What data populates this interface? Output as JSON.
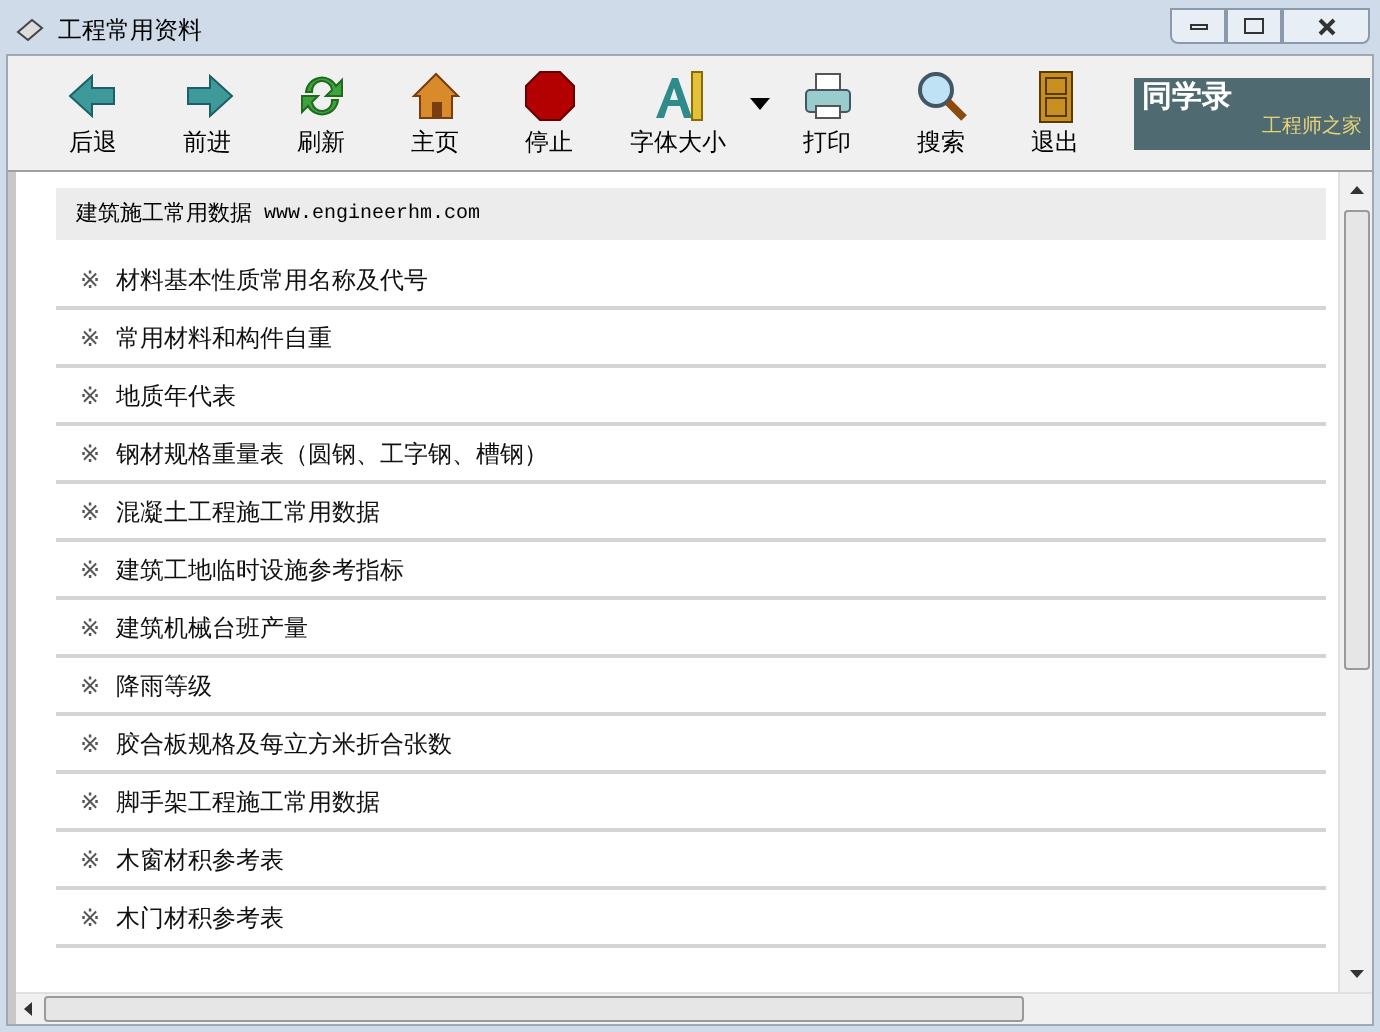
{
  "window": {
    "title": "工程常用资料"
  },
  "toolbar": [
    {
      "kind": "back",
      "label": "后退"
    },
    {
      "kind": "forward",
      "label": "前进"
    },
    {
      "kind": "refresh",
      "label": "刷新"
    },
    {
      "kind": "home",
      "label": "主页"
    },
    {
      "kind": "stop",
      "label": "停止"
    },
    {
      "kind": "font",
      "label": "字体大小"
    },
    {
      "kind": "print",
      "label": "打印"
    },
    {
      "kind": "search",
      "label": "搜索"
    },
    {
      "kind": "exit",
      "label": "退出"
    }
  ],
  "logo": {
    "title": "同学录",
    "subtitle": "工程师之家"
  },
  "page": {
    "heading": "建筑施工常用数据",
    "url": "www.engineerhm.com",
    "items": [
      {
        "mark": "※",
        "text": "材料基本性质常用名称及代号"
      },
      {
        "mark": "※",
        "text": "常用材料和构件自重"
      },
      {
        "mark": "※",
        "text": "地质年代表"
      },
      {
        "mark": "※",
        "text": "钢材规格重量表（圆钢、工字钢、槽钢）"
      },
      {
        "mark": "※",
        "text": "混凝土工程施工常用数据"
      },
      {
        "mark": "※",
        "text": "建筑工地临时设施参考指标"
      },
      {
        "mark": "※",
        "text": "建筑机械台班产量"
      },
      {
        "mark": "※",
        "text": "降雨等级"
      },
      {
        "mark": "※",
        "text": "胶合板规格及每立方米折合张数"
      },
      {
        "mark": "※",
        "text": "脚手架工程施工常用数据"
      },
      {
        "mark": "※",
        "text": "木窗材积参考表"
      },
      {
        "mark": "※",
        "text": "木门材积参考表"
      }
    ]
  }
}
